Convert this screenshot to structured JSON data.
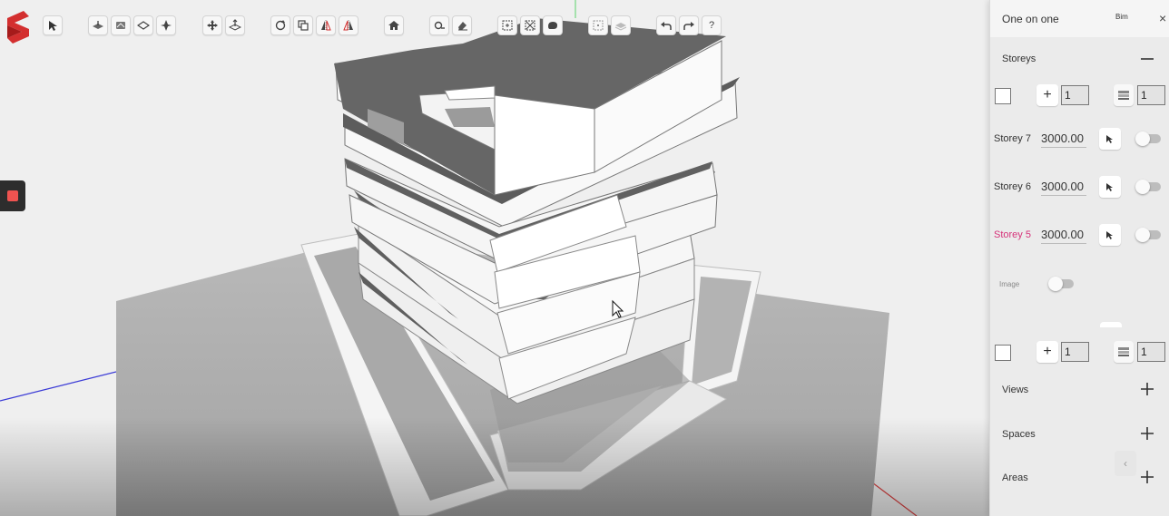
{
  "app": {
    "logo_icon": "app-logo-icon",
    "record_icon": "record-stop-icon"
  },
  "toolbar": {
    "buttons": [
      {
        "id": "select",
        "icon": "cursor-arrow-icon"
      },
      {
        "id": "floor-plane",
        "icon": "floor-plane-icon"
      },
      {
        "id": "slab",
        "icon": "slab-icon"
      },
      {
        "id": "diamond",
        "icon": "diamond-plane-icon"
      },
      {
        "id": "snap",
        "icon": "snap-icon"
      },
      {
        "id": "move",
        "icon": "move-arrows-icon"
      },
      {
        "id": "elevate",
        "icon": "elevate-icon"
      },
      {
        "id": "rotate",
        "icon": "rotate-icon"
      },
      {
        "id": "copy",
        "icon": "copy-icon"
      },
      {
        "id": "mirror-x",
        "icon": "mirror-x-icon"
      },
      {
        "id": "mirror-y",
        "icon": "mirror-y-icon"
      },
      {
        "id": "home",
        "icon": "home-icon"
      },
      {
        "id": "measure",
        "icon": "measure-icon"
      },
      {
        "id": "eraser",
        "icon": "eraser-icon"
      },
      {
        "id": "import",
        "icon": "import-icon"
      },
      {
        "id": "scan",
        "icon": "scan-icon"
      },
      {
        "id": "paint",
        "icon": "paint-icon"
      },
      {
        "id": "group",
        "icon": "group-icon"
      },
      {
        "id": "layers",
        "icon": "layers-icon"
      },
      {
        "id": "undo",
        "icon": "undo-icon"
      },
      {
        "id": "redo",
        "icon": "redo-icon"
      },
      {
        "id": "help",
        "icon": "help-icon",
        "label": "?"
      }
    ]
  },
  "panel": {
    "title": "One on one",
    "bim_label": "Bim",
    "close_label": "×",
    "storeys_section": {
      "label": "Storeys",
      "collapse_label": "—"
    },
    "top_controls": {
      "plus_label": "+",
      "count_value": "1",
      "layers_value": "1"
    },
    "storeys": [
      {
        "name": "Storey 7",
        "height": "3000.00",
        "active": false
      },
      {
        "name": "Storey 6",
        "height": "3000.00",
        "active": false
      },
      {
        "name": "Storey 5",
        "height": "3000.00",
        "active": true
      }
    ],
    "image_label": "Image",
    "bottom_controls": {
      "plus_label": "+",
      "count_value": "1",
      "layers_value": "1"
    },
    "sections": [
      {
        "label": "Views",
        "add_label": "+"
      },
      {
        "label": "Spaces",
        "add_label": "+"
      },
      {
        "label": "Areas",
        "add_label": "+"
      }
    ],
    "chevron_label": "‹"
  },
  "colors": {
    "active_storey": "#d6337a",
    "logo_red": "#d32f2f",
    "record_red": "#ef5350",
    "slab_dark": "#6b6b6b"
  }
}
